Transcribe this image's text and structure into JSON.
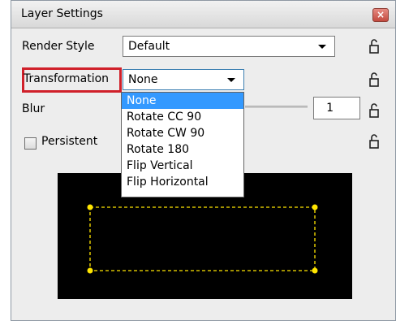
{
  "window": {
    "title": "Layer Settings",
    "close_glyph": "×"
  },
  "render_style": {
    "label": "Render Style",
    "value": "Default"
  },
  "transformation": {
    "label": "Transformation",
    "value": "None",
    "options": [
      "None",
      "Rotate CC 90",
      "Rotate CW 90",
      "Rotate 180",
      "Flip Vertical",
      "Flip Horizontal"
    ],
    "selected_index": 0
  },
  "blur": {
    "label": "Blur",
    "value": "1"
  },
  "persistent": {
    "label": "Persistent",
    "checked": false
  },
  "colors": {
    "highlight": "#d0202a",
    "selection": "#3399ff",
    "preview_bg": "#000000",
    "handles": "#ffe500"
  },
  "icons": {
    "lock": "lock-icon",
    "dropdown_arrow": "chevron-down-icon",
    "close": "close-icon"
  }
}
